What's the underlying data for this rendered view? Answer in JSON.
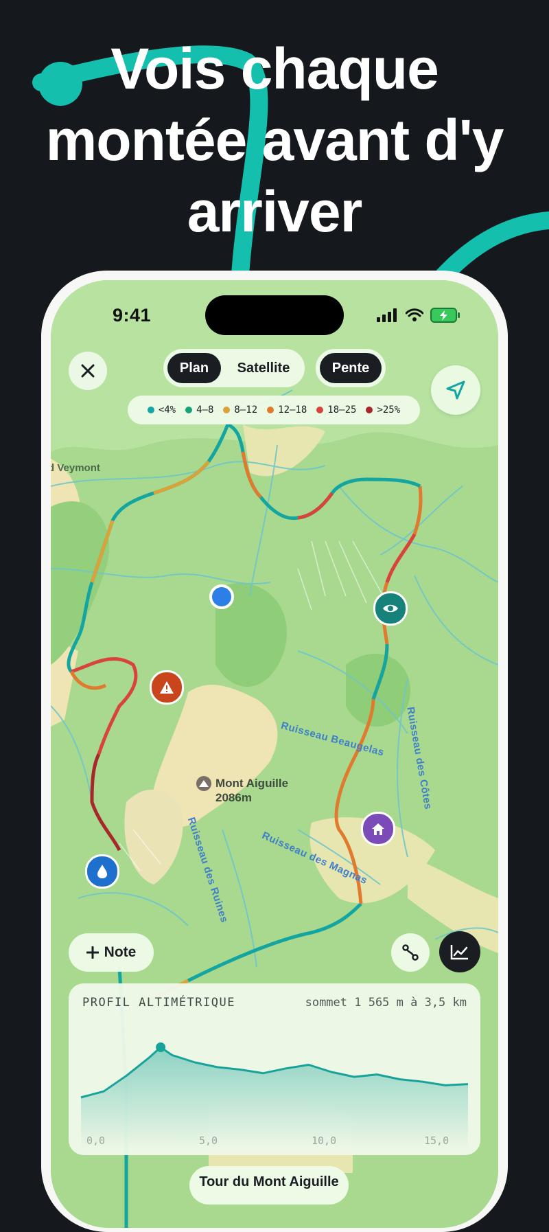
{
  "headline": {
    "line1": "Vois chaque",
    "line2": "montée avant d'y",
    "line3": "arriver"
  },
  "status_bar": {
    "time": "9:41",
    "icons": [
      "cellular-signal-icon",
      "wifi-icon",
      "battery-charging-icon"
    ]
  },
  "map_controls": {
    "close_icon": "close-icon",
    "layer_plan": "Plan",
    "layer_satellite": "Satellite",
    "pente_toggle": "Pente",
    "locate_icon": "location-arrow-icon"
  },
  "slope_legend": [
    {
      "label": "<4%",
      "color": "#12a7a8"
    },
    {
      "label": "4–8",
      "color": "#17a37a"
    },
    {
      "label": "8–12",
      "color": "#d9a23a"
    },
    {
      "label": "12–18",
      "color": "#e07a2e"
    },
    {
      "label": "18–25",
      "color": "#d9443a"
    },
    {
      "label": ">25%",
      "color": "#a7282b"
    }
  ],
  "map_labels": {
    "place": "d Veymont",
    "peak_name": "Mont Aiguille",
    "peak_elevation": "2086m",
    "stream_beaugelas": "Ruisseau Beaugelas",
    "stream_cotes": "Ruisseau des Côtes",
    "stream_magnas": "Ruisseau des Magnas",
    "stream_ruines": "Ruisseau des Ruines"
  },
  "pois": [
    {
      "name": "current-position",
      "color": "#2b7fe6"
    },
    {
      "name": "viewpoint",
      "color": "#17827a",
      "icon": "eye-icon"
    },
    {
      "name": "danger",
      "color": "#c9461c",
      "icon": "warning-icon"
    },
    {
      "name": "shelter",
      "color": "#7b4bb8",
      "icon": "home-icon"
    },
    {
      "name": "water",
      "color": "#1f6fce",
      "icon": "water-drop-icon"
    }
  ],
  "actions": {
    "note_label": "Note",
    "note_icon": "plus-icon",
    "route_icon": "route-icon",
    "chart_icon": "line-chart-icon"
  },
  "profile": {
    "title": "PROFIL ALTIMÉTRIQUE",
    "summit": "sommet 1 565 m à 3,5 km",
    "x_ticks": [
      "0,0",
      "5,0",
      "10,0",
      "15,0"
    ]
  },
  "chart_data": {
    "type": "area",
    "title": "PROFIL ALTIMÉTRIQUE",
    "xlabel": "",
    "ylabel": "",
    "x": [
      0,
      1,
      2,
      3,
      3.5,
      4,
      5,
      6,
      7,
      8,
      9,
      10,
      11,
      12,
      13,
      14,
      15,
      16,
      17
    ],
    "series": [
      {
        "values": [
          1150,
          1200,
          1330,
          1480,
          1565,
          1500,
          1440,
          1400,
          1380,
          1350,
          1390,
          1420,
          1360,
          1320,
          1340,
          1300,
          1280,
          1250,
          1260
        ]
      }
    ],
    "highlight": {
      "x": 3.5,
      "y": 1565
    },
    "xlim": [
      0,
      17
    ],
    "color": "#17a39a"
  },
  "trip": {
    "title": "Tour du Mont Aiguille"
  }
}
